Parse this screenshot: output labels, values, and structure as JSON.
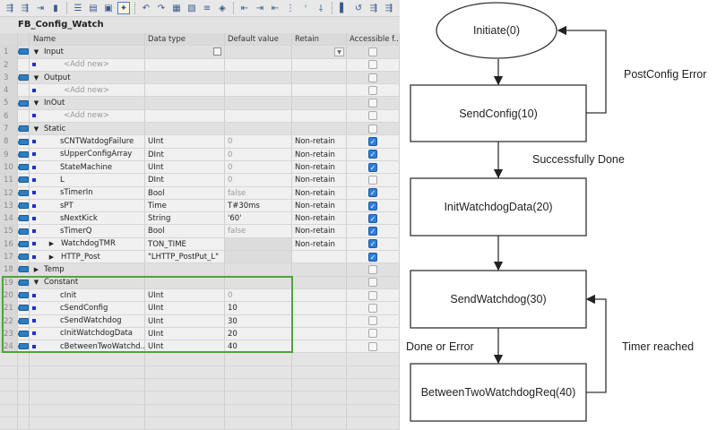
{
  "toolbar": {
    "icons": [
      "insert-row-icon",
      "add-row-icon",
      "expand-icon",
      "monitor-icon",
      "list-icon",
      "grid-icon",
      "download-icon",
      "highlight-icon",
      "go-online-icon",
      "go-offline-icon",
      "compile-icon",
      "snapshot-icon",
      "indent-icon",
      "watch-icon",
      "left-align-icon",
      "indent-right-icon",
      "outdent-icon",
      "columns-icon",
      "sort-icon",
      "filter-icon",
      "breakpoint-icon",
      "step-icon",
      "refresh-icon",
      "jump-icon"
    ]
  },
  "editor": {
    "title": "FB_Config_Watch",
    "columns": [
      "Name",
      "Data type",
      "Default value",
      "Retain",
      "Accessible f..."
    ],
    "rows": [
      {
        "n": "1",
        "kind": "section",
        "name": "Input",
        "expanded": true,
        "dt": "",
        "dv": "",
        "re": "",
        "acc": false
      },
      {
        "n": "2",
        "kind": "add",
        "name": "<Add new>",
        "dt": "",
        "dv": "",
        "re": "",
        "acc": false
      },
      {
        "n": "3",
        "kind": "section",
        "name": "Output",
        "expanded": true,
        "dt": "",
        "dv": "",
        "re": "",
        "acc": false
      },
      {
        "n": "4",
        "kind": "add",
        "name": "<Add new>",
        "dt": "",
        "dv": "",
        "re": "",
        "acc": false
      },
      {
        "n": "5",
        "kind": "section",
        "name": "InOut",
        "expanded": true,
        "dt": "",
        "dv": "",
        "re": "",
        "acc": false
      },
      {
        "n": "6",
        "kind": "add",
        "name": "<Add new>",
        "dt": "",
        "dv": "",
        "re": "",
        "acc": false
      },
      {
        "n": "7",
        "kind": "section",
        "name": "Static",
        "expanded": true,
        "dt": "",
        "dv": "",
        "re": "",
        "acc": false
      },
      {
        "n": "8",
        "kind": "var",
        "name": "sCNTWatdogFailure",
        "dt": "UInt",
        "dv": "0",
        "re": "Non-retain",
        "acc": true
      },
      {
        "n": "9",
        "kind": "var",
        "name": "sUpperConfigArray",
        "dt": "DInt",
        "dv": "0",
        "re": "Non-retain",
        "acc": true
      },
      {
        "n": "10",
        "kind": "var",
        "name": "StateMachine",
        "dt": "UInt",
        "dv": "0",
        "re": "Non-retain",
        "acc": true
      },
      {
        "n": "11",
        "kind": "var",
        "name": "L",
        "dt": "DInt",
        "dv": "0",
        "re": "Non-retain",
        "acc": false
      },
      {
        "n": "12",
        "kind": "var",
        "name": "sTimerIn",
        "dt": "Bool",
        "dv": "false",
        "re": "Non-retain",
        "acc": true
      },
      {
        "n": "13",
        "kind": "var",
        "name": "sPT",
        "dt": "Time",
        "dv": "T#30ms",
        "re": "Non-retain",
        "acc": true
      },
      {
        "n": "14",
        "kind": "var",
        "name": "sNextKick",
        "dt": "String",
        "dv": "'60'",
        "re": "Non-retain",
        "acc": true
      },
      {
        "n": "15",
        "kind": "var",
        "name": "sTimerQ",
        "dt": "Bool",
        "dv": "false",
        "re": "Non-retain",
        "acc": true
      },
      {
        "n": "16",
        "kind": "struct",
        "name": "WatchdogTMR",
        "dt": "TON_TIME",
        "dv": "",
        "re": "Non-retain",
        "acc": true
      },
      {
        "n": "17",
        "kind": "struct",
        "name": "HTTP_Post",
        "dt": "\"LHTTP_PostPut_L\"",
        "dv": "",
        "re": "",
        "acc": true
      },
      {
        "n": "18",
        "kind": "section",
        "name": "Temp",
        "expanded": false,
        "dt": "",
        "dv": "",
        "re": "",
        "acc": false
      },
      {
        "n": "19",
        "kind": "section",
        "name": "Constant",
        "expanded": true,
        "dt": "",
        "dv": "",
        "re": "",
        "acc": false
      },
      {
        "n": "20",
        "kind": "var",
        "name": "cInit",
        "dt": "UInt",
        "dv": "0",
        "re": "",
        "acc": false
      },
      {
        "n": "21",
        "kind": "var",
        "name": "cSendConfig",
        "dt": "UInt",
        "dv": "10",
        "re": "",
        "acc": false
      },
      {
        "n": "22",
        "kind": "var",
        "name": "cSendWatchdog",
        "dt": "UInt",
        "dv": "30",
        "re": "",
        "acc": false
      },
      {
        "n": "23",
        "kind": "var",
        "name": "cInitWatchdogData",
        "dt": "UInt",
        "dv": "20",
        "re": "",
        "acc": false
      },
      {
        "n": "24",
        "kind": "var",
        "name": "cBetweenTwoWatchd...",
        "dt": "UInt",
        "dv": "40",
        "re": "",
        "acc": false
      }
    ],
    "highlight_color": "#4fa33a"
  },
  "diagram": {
    "states": [
      "Initiate(0)",
      "SendConfig(10)",
      "InitWatchdogData(20)",
      "SendWatchdog(30)",
      "BetweenTwoWatchdogReq(40)"
    ],
    "transitions": [
      "PostConfig Error",
      "Successfully Done",
      "Done or Error",
      "Timer reached"
    ]
  }
}
